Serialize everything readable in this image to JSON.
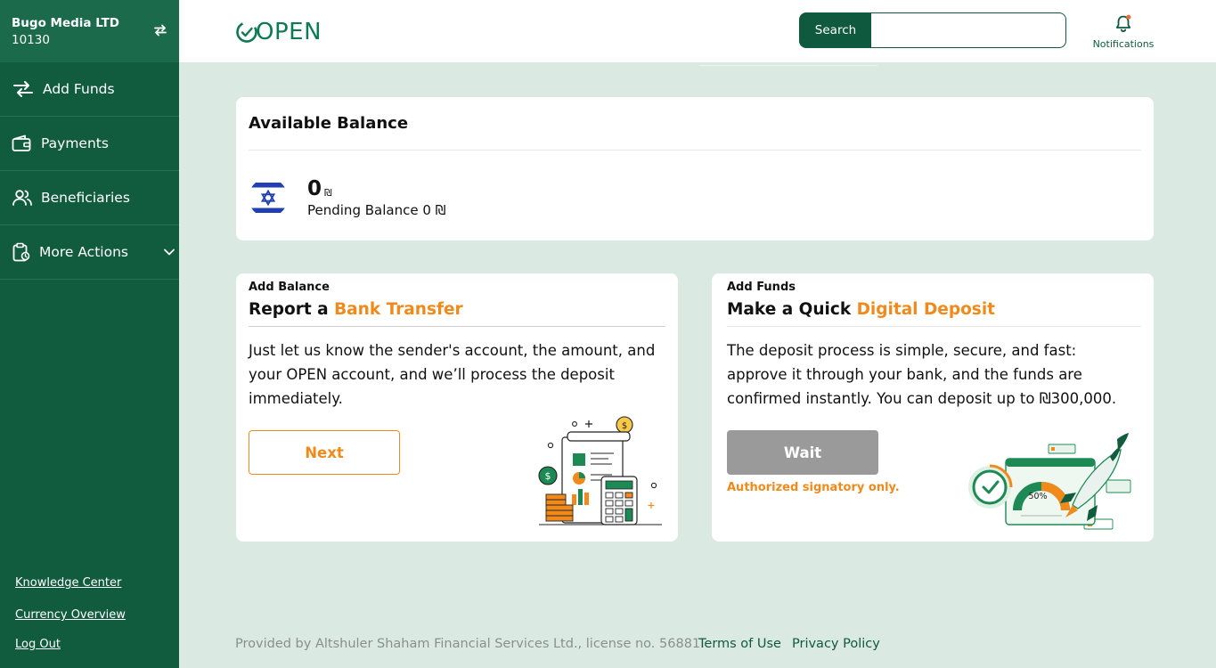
{
  "account": {
    "name": "Bugo Media LTD",
    "id": "10130"
  },
  "sidebar": {
    "items": [
      {
        "label": "Add Funds",
        "icon": "transfer-arrows-icon"
      },
      {
        "label": "Payments",
        "icon": "wallet-icon"
      },
      {
        "label": "Beneficiaries",
        "icon": "users-icon"
      },
      {
        "label": "More Actions",
        "icon": "clipboard-icon"
      }
    ],
    "links": [
      "Knowledge Center",
      "Currency Overview",
      "Log Out"
    ]
  },
  "header": {
    "logo": "OPEN",
    "search_label": "Search",
    "search_placeholder": "",
    "notifications_label": "Notifications"
  },
  "balance": {
    "title": "Available Balance",
    "amount": "0",
    "currency_symbol": "₪",
    "pending": "Pending Balance 0 ₪"
  },
  "bank_transfer": {
    "kicker": "Add Balance",
    "title_prefix": "Report a ",
    "title_highlight": "Bank Transfer",
    "body": "Just let us know the sender's account, the amount, and your OPEN account, and we’ll process the deposit immediately.",
    "button": "Next"
  },
  "digital_deposit": {
    "kicker": "Add Funds",
    "title_prefix": "Make a Quick ",
    "title_highlight": "Digital Deposit",
    "body": "The deposit process is simple, secure, and fast: approve it through your bank, and the funds are confirmed instantly. You can deposit up to ₪300,000.",
    "button": "Wait",
    "note": "Authorized signatory only.",
    "illustration_label": "50%"
  },
  "footer": {
    "text": "Provided by Altshuler Shaham Financial Services Ltd., license no. 56881.",
    "terms": "Terms of Use",
    "privacy": "Privacy Policy"
  },
  "colors": {
    "primary": "#115c3f",
    "accent": "#f08a1c",
    "background": "#dbe9e3"
  }
}
